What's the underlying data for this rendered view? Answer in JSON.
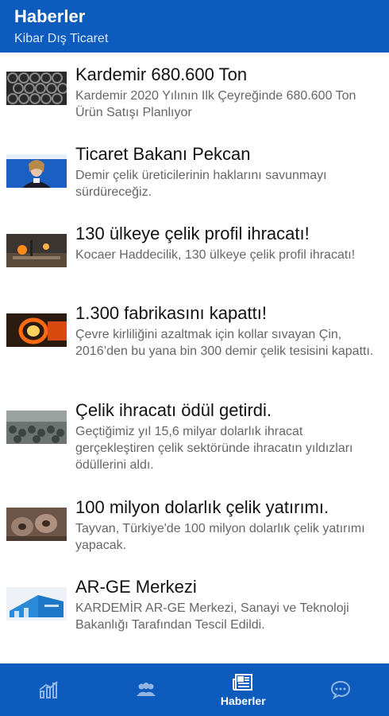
{
  "header": {
    "title": "Haberler",
    "subtitle": "Kibar Dış Ticaret"
  },
  "news": [
    {
      "title": "Kardemir 680.600 Ton",
      "summary": "Kardemir 2020 Yılının Ilk Çeyreğinde 680.600 Ton Ürün Satışı Planlıyor"
    },
    {
      "title": "Ticaret Bakanı Pekcan",
      "summary": "Demir çelik üreticilerinin haklarını savunmayı sürdüreceğiz."
    },
    {
      "title": "130 ülkeye çelik profil ihracatı!",
      "summary": "Kocaer Haddecilik, 130 ülkeye çelik profil ihracatı!"
    },
    {
      "title": "1.300 fabrikasını kapattı!",
      "summary": "Çevre kirliliğini azaltmak için kollar sıvayan Çin, 2016’den bu yana bin 300 demir çelik tesisini kapattı."
    },
    {
      "title": "Çelik ihracatı ödül getirdi.",
      "summary": "Geçtiğimiz yıl 15,6 milyar dolarlık ihracat gerçekleştiren çelik sektöründe ihracatın yıldızları ödüllerini aldı."
    },
    {
      "title": "100 milyon dolarlık çelik yatırımı.",
      "summary": "Tayvan, Türkiye'de 100 milyon dolarlık çelik yatırımı yapacak."
    },
    {
      "title": "AR-GE Merkezi",
      "summary": "KARDEMİR AR-GE Merkezi, Sanayi ve Teknoloji Bakanlığı Tarafından Tescil Edildi."
    }
  ],
  "bottom_nav": {
    "items": [
      {
        "icon": "chart-icon",
        "label": ""
      },
      {
        "icon": "people-icon",
        "label": ""
      },
      {
        "icon": "newspaper-icon",
        "label": "Haberler",
        "active": true
      },
      {
        "icon": "chat-bubble-icon",
        "label": ""
      }
    ]
  },
  "colors": {
    "primary": "#0d5bbd",
    "title_text": "#111111",
    "summary_text": "#666666"
  }
}
